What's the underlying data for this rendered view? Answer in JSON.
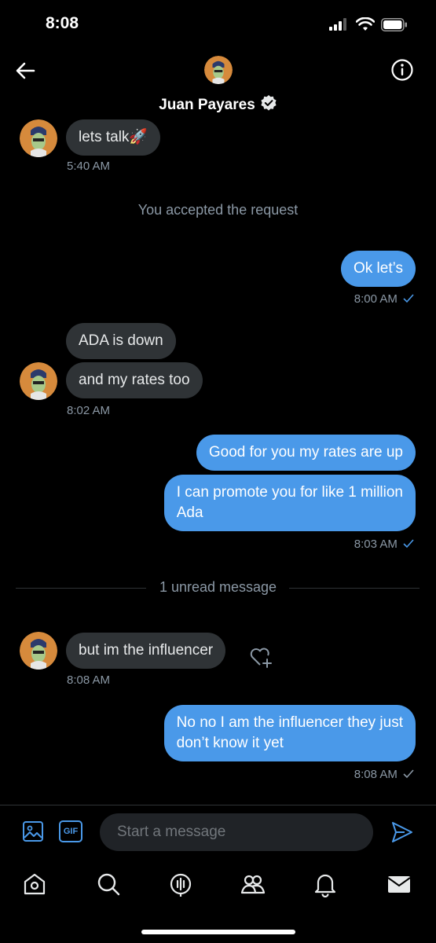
{
  "status_bar": {
    "time": "8:08"
  },
  "header": {
    "name": "Juan Payares"
  },
  "messages": {
    "m1": {
      "text": "lets talk🚀",
      "time": "5:40 AM"
    },
    "system_accepted": "You accepted the request",
    "m2": {
      "text": "Ok let’s",
      "time": "8:00 AM"
    },
    "m3": {
      "text": "ADA is down"
    },
    "m4": {
      "text": "and my rates too",
      "time": "8:02 AM"
    },
    "m5": {
      "text": "Good for you my rates are up"
    },
    "m6": {
      "line1": "I can promote you for like 1 million",
      "line2": "Ada",
      "time": "8:03 AM"
    },
    "unread": "1 unread message",
    "m7": {
      "text": "but im the influencer",
      "time": "8:08 AM"
    },
    "m8": {
      "line1": "No no I am the influencer they just",
      "line2": "don’t know it yet",
      "time": "8:08 AM"
    }
  },
  "composer": {
    "placeholder": "Start a message",
    "gif_label": "GIF"
  },
  "colors": {
    "accent": "#4a99e9",
    "received_bubble": "#2f3336",
    "background": "#000000"
  },
  "icons": [
    "back-arrow-icon",
    "info-icon",
    "verified-icon",
    "image-icon",
    "gif-icon",
    "send-icon",
    "home-icon",
    "search-icon",
    "spaces-icon",
    "communities-icon",
    "bell-icon",
    "mail-icon",
    "react-heart-icon"
  ]
}
